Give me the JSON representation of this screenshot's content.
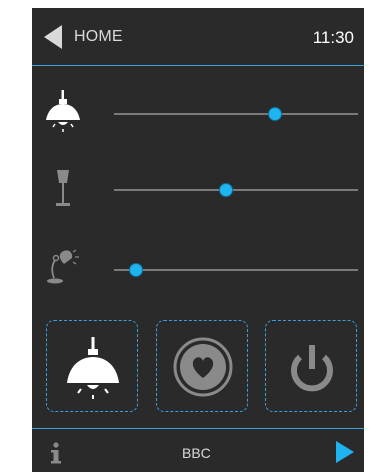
{
  "header": {
    "back_label": "HOME",
    "time": "11:30"
  },
  "colors": {
    "accent": "#1fb4f0",
    "divider": "#3b9fe0",
    "panel_bg": "#2a2a2a",
    "icon": "#ffffff",
    "icon_muted": "#8a8a8a"
  },
  "lights": [
    {
      "name": "pendant-lamp",
      "icon": "pendant-lamp-icon",
      "level": 0.66
    },
    {
      "name": "floor-lamp",
      "icon": "floor-lamp-icon",
      "level": 0.46
    },
    {
      "name": "desk-lamp",
      "icon": "desk-lamp-icon",
      "level": 0.09
    }
  ],
  "tiles": [
    {
      "name": "pendant-lamp-tile",
      "icon": "pendant-lamp-icon",
      "active": true
    },
    {
      "name": "favorite-tile",
      "icon": "heart-icon",
      "active": false
    },
    {
      "name": "power-tile",
      "icon": "power-icon",
      "active": false
    }
  ],
  "footer": {
    "info_icon": "info-icon",
    "station": "BBC",
    "play_icon": "play-icon"
  }
}
